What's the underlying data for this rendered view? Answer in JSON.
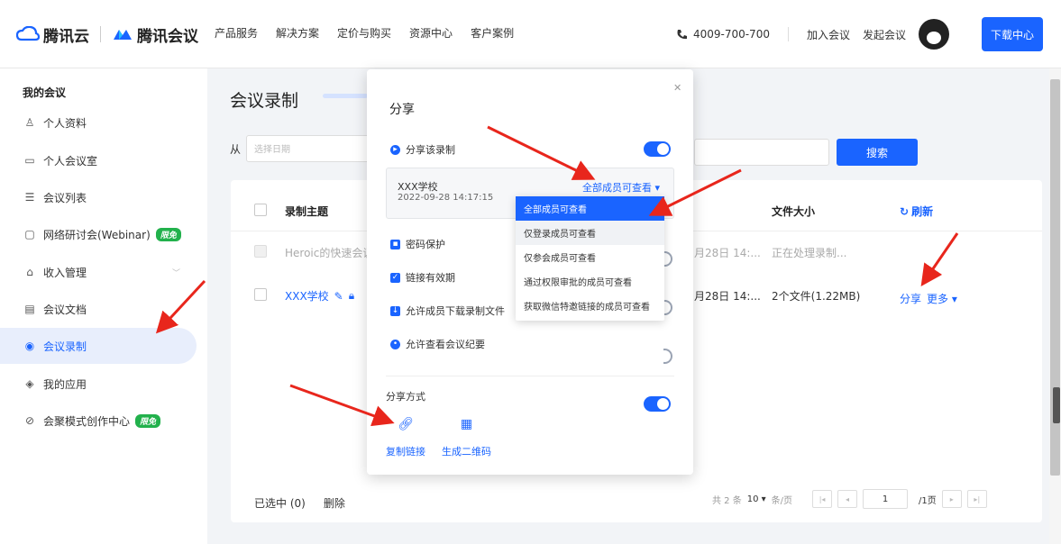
{
  "header": {
    "brand1": "腾讯云",
    "brand2": "腾讯会议",
    "nav": [
      "产品服务",
      "解决方案",
      "定价与购买",
      "资源中心",
      "客户案例"
    ],
    "phone": "4009-700-700",
    "join": "加入会议",
    "start": "发起会议",
    "download": "下载中心"
  },
  "sidebar": {
    "title": "我的会议",
    "items": [
      {
        "label": "个人资料",
        "icon": "user-icon"
      },
      {
        "label": "个人会议室",
        "icon": "room-icon"
      },
      {
        "label": "会议列表",
        "icon": "list-icon"
      },
      {
        "label": "网络研讨会(Webinar)",
        "icon": "webinar-icon",
        "badge": "限免"
      },
      {
        "label": "收入管理",
        "icon": "income-icon"
      },
      {
        "label": "会议文档",
        "icon": "doc-icon"
      },
      {
        "label": "会议录制",
        "icon": "record-icon"
      },
      {
        "label": "我的应用",
        "icon": "app-icon"
      },
      {
        "label": "会聚模式创作中心",
        "icon": "studio-icon",
        "badge": "限免"
      }
    ]
  },
  "main": {
    "title": "会议录制",
    "from_label": "从",
    "date_placeholder": "选择日期",
    "search": "搜索",
    "columns": {
      "topic": "录制主题",
      "size": "文件大小",
      "refresh": "刷新"
    },
    "rows": [
      {
        "topic": "Heroic的快速会议",
        "time": "月28日 14:...",
        "size": "正在处理录制..."
      },
      {
        "topic": "XXX学校",
        "time": "月28日 14:...",
        "size": "2个文件(1.22MB)",
        "share": "分享",
        "more": "更多"
      }
    ],
    "footer": {
      "selected": "已选中 (0)",
      "delete": "删除",
      "total": "共 2 条",
      "per_page": "10",
      "per_unit": "条/页",
      "page": "1",
      "pages": "/1页"
    }
  },
  "modal": {
    "title": "分享",
    "share_recording": "分享该录制",
    "box_name": "XXX学校",
    "box_time": "2022-09-28 14:17:15",
    "permission": "全部成员可查看",
    "options": [
      "全部成员可查看",
      "仅登录成员可查看",
      "仅参会成员可查看",
      "通过权限审批的成员可查看",
      "获取微信特邀链接的成员可查看"
    ],
    "password": "密码保护",
    "validity": "链接有效期",
    "allow_download": "允许成员下载录制文件",
    "allow_summary": "允许查看会议纪要",
    "share_method": "分享方式",
    "copy_link": "复制链接",
    "qr_code": "生成二维码"
  },
  "colors": {
    "accent": "#1a64ff",
    "arrow": "#e8261c",
    "badge": "#22b14c"
  }
}
